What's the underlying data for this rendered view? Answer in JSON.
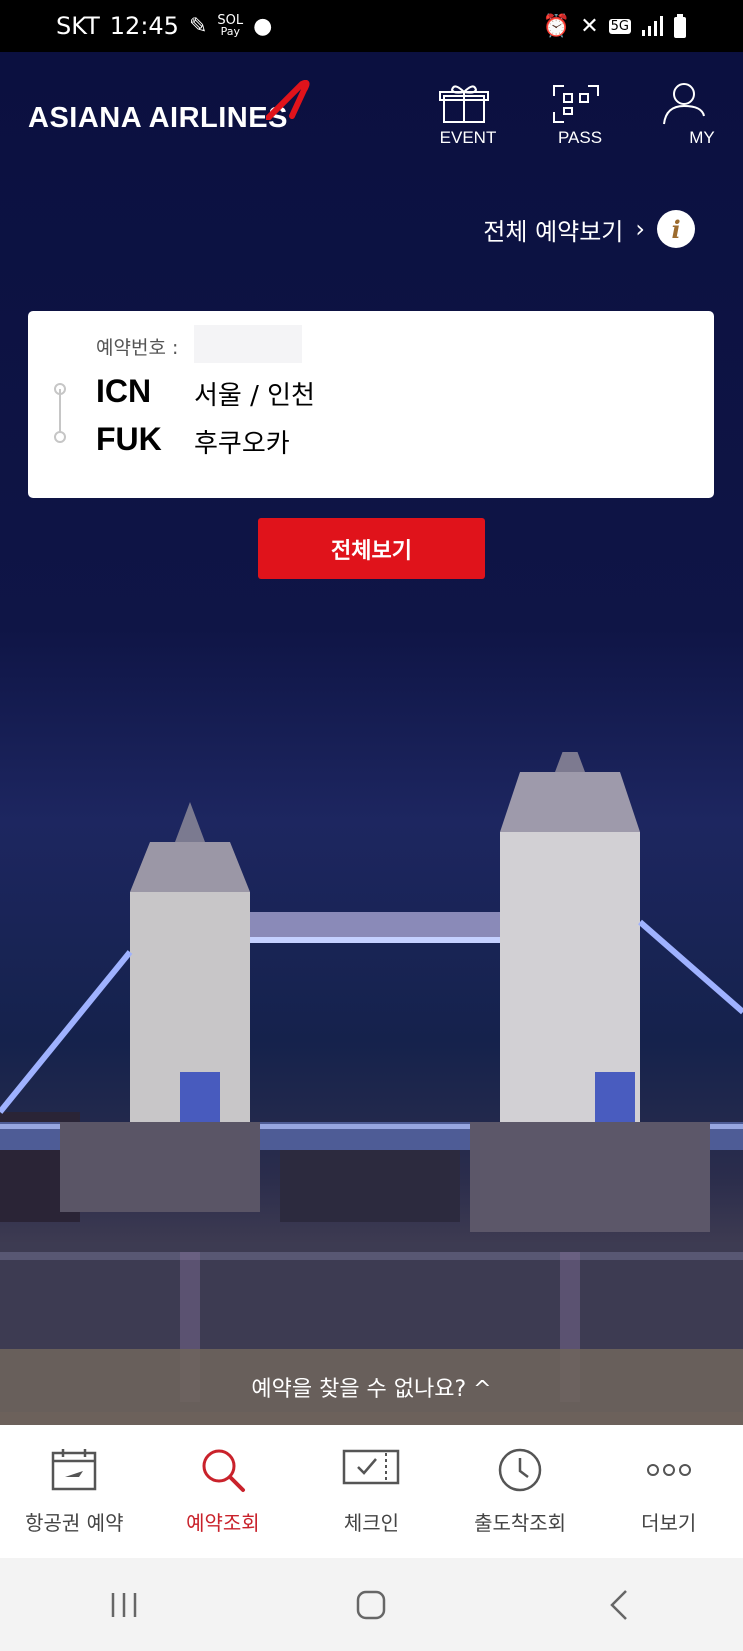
{
  "status_bar": {
    "carrier": "SKT",
    "time": "12:45",
    "pay_label": "Pay",
    "network": "5G"
  },
  "header": {
    "logo_text": "ASIANA AIRLINES",
    "event_label": "EVENT",
    "pass_label": "PASS",
    "my_label": "MY"
  },
  "all_reservations_link": "전체 예약보기",
  "booking": {
    "reservation_label": "예약번호 :",
    "origin_code": "ICN",
    "origin_city": "서울 / 인천",
    "destination_code": "FUK",
    "destination_city": "후쿠오카"
  },
  "view_all_button": "전체보기",
  "not_found_bar": "예약을 찾을 수 없나요? ^",
  "bottom_nav": [
    {
      "label": "항공권 예약",
      "icon": "calendar-plane-icon"
    },
    {
      "label": "예약조회",
      "icon": "search-icon",
      "active": true
    },
    {
      "label": "체크인",
      "icon": "ticket-check-icon"
    },
    {
      "label": "출도착조회",
      "icon": "clock-icon"
    },
    {
      "label": "더보기",
      "icon": "more-dots-icon"
    }
  ],
  "colors": {
    "accent_red": "#e0131b",
    "active_nav": "#c9222b",
    "background_navy": "#0b0f3b"
  }
}
